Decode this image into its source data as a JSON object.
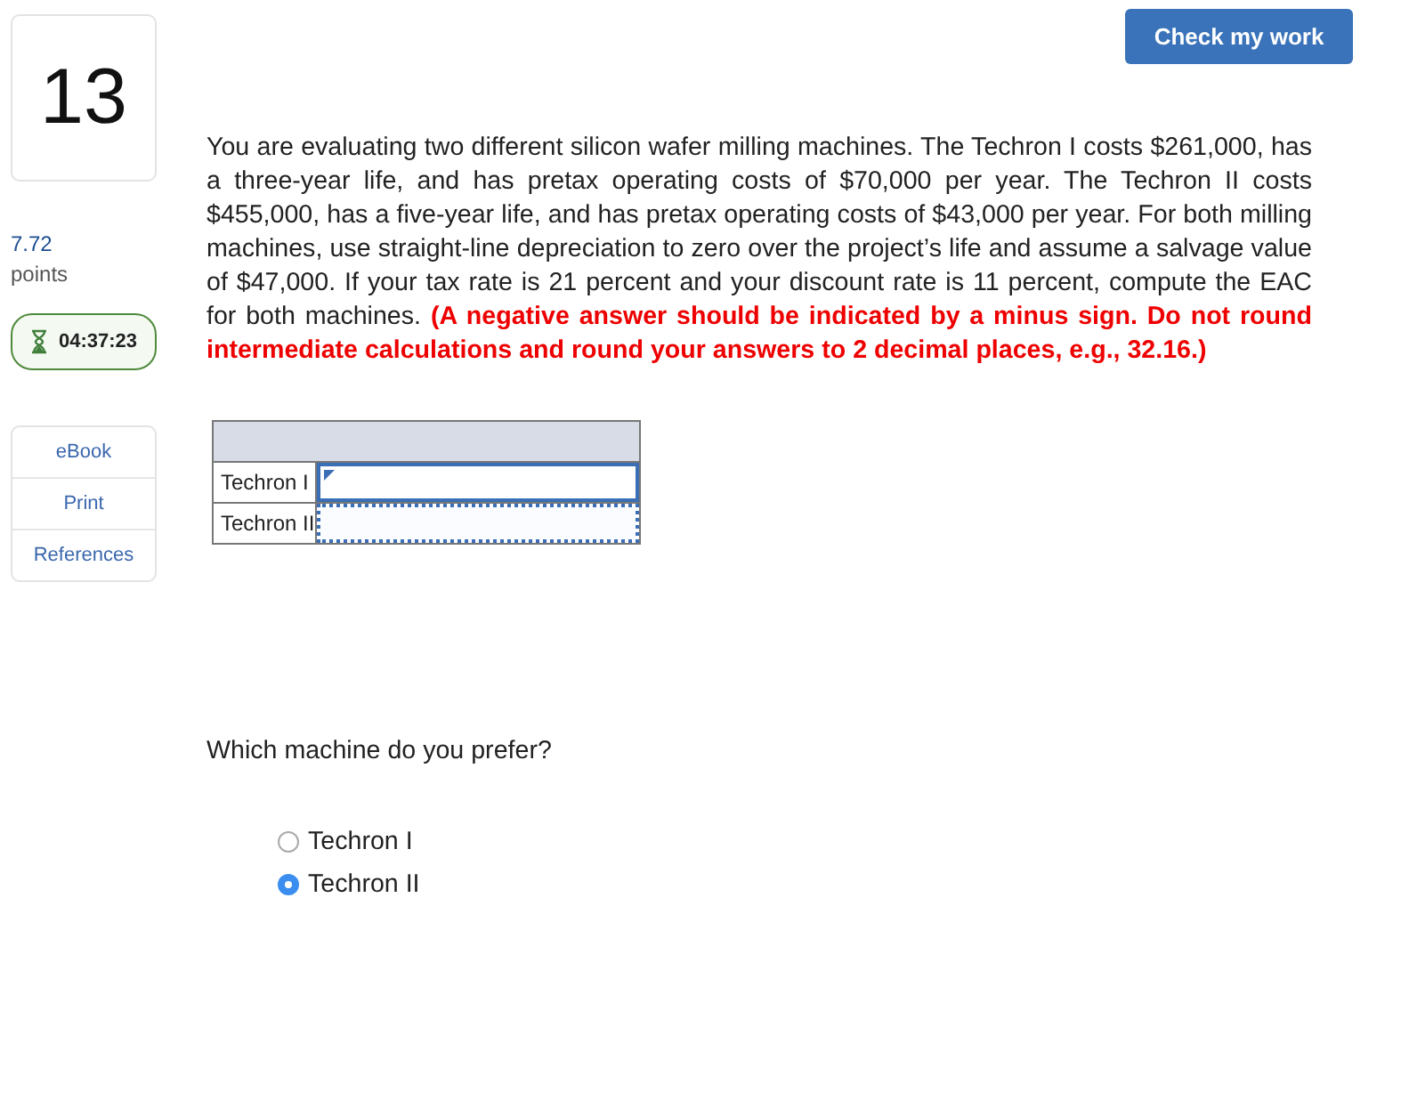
{
  "question_number": "13",
  "score": {
    "value": "7.72",
    "label": "points"
  },
  "timer": "04:37:23",
  "resources": [
    "eBook",
    "Print",
    "References"
  ],
  "check_button": "Check my work",
  "problem": {
    "text": "You are evaluating two different silicon wafer milling machines. The Techron I costs $261,000, has a three-year life, and has pretax operating costs of $70,000 per year. The Techron II costs $455,000, has a five-year life, and has pretax operating costs of $43,000 per year. For both milling machines, use straight-line depreciation to zero over the project’s life and assume a salvage value of $47,000. If your tax rate is 21 percent and your discount rate is 11 percent, compute the EAC for both machines.",
    "instruction": "(A negative answer should be indicated by a minus sign. Do not round intermediate calculations and round your answers to 2 decimal places, e.g., 32.16.)"
  },
  "answer_table": {
    "rows": [
      {
        "label": "Techron I",
        "focused": true
      },
      {
        "label": "Techron II",
        "focused": false
      }
    ]
  },
  "preference": {
    "question": "Which machine do you prefer?",
    "options": [
      {
        "label": "Techron I",
        "selected": false
      },
      {
        "label": "Techron II",
        "selected": true
      }
    ]
  }
}
